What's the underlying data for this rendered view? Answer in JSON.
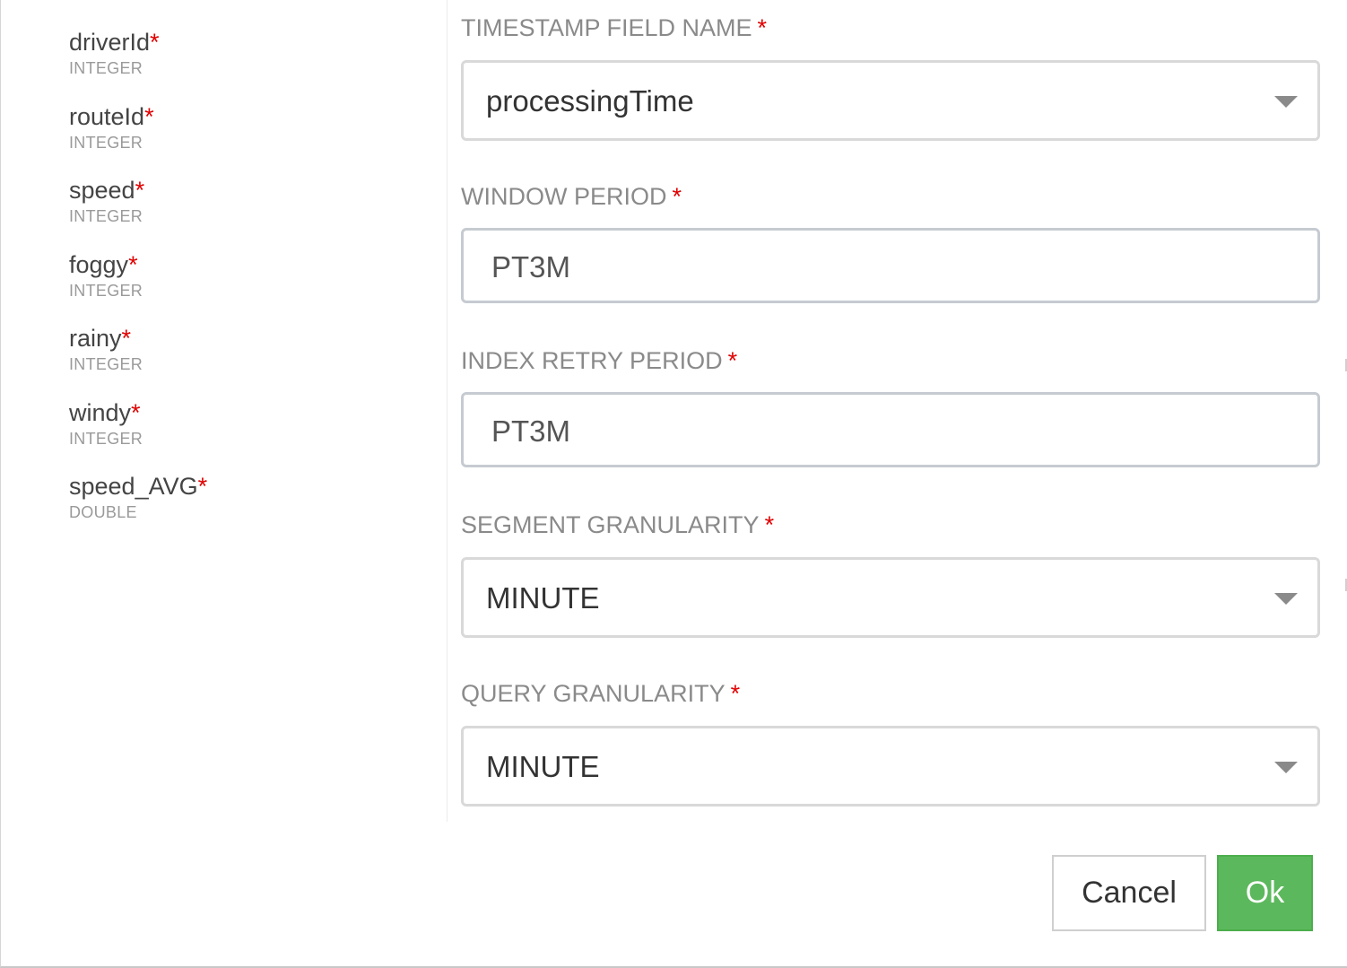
{
  "schema": {
    "fields": [
      {
        "name": "driverId",
        "type": "INTEGER",
        "required_mark": "*"
      },
      {
        "name": "routeId",
        "type": "INTEGER",
        "required_mark": "*"
      },
      {
        "name": "speed",
        "type": "INTEGER",
        "required_mark": "*"
      },
      {
        "name": "foggy",
        "type": "INTEGER",
        "required_mark": "*"
      },
      {
        "name": "rainy",
        "type": "INTEGER",
        "required_mark": "*"
      },
      {
        "name": "windy",
        "type": "INTEGER",
        "required_mark": "*"
      },
      {
        "name": "speed_AVG",
        "type": "DOUBLE",
        "required_mark": "*"
      }
    ]
  },
  "form": {
    "timestamp_field": {
      "label": "TIMESTAMP FIELD NAME",
      "required_mark": "*",
      "value": "processingTime"
    },
    "window_period": {
      "label": "WINDOW PERIOD",
      "required_mark": "*",
      "value": "PT3M"
    },
    "index_retry_period": {
      "label": "INDEX RETRY PERIOD",
      "required_mark": "*",
      "value": "PT3M"
    },
    "segment_granularity": {
      "label": "SEGMENT GRANULARITY",
      "required_mark": "*",
      "value": "MINUTE"
    },
    "query_granularity": {
      "label": "QUERY GRANULARITY",
      "required_mark": "*",
      "value": "MINUTE"
    }
  },
  "footer": {
    "cancel_label": "Cancel",
    "ok_label": "Ok"
  },
  "colors": {
    "required": "#e00000",
    "ok_button": "#5cb85c",
    "label": "#8a8a8a"
  },
  "icons": {
    "select_caret": "caret-down-icon"
  }
}
